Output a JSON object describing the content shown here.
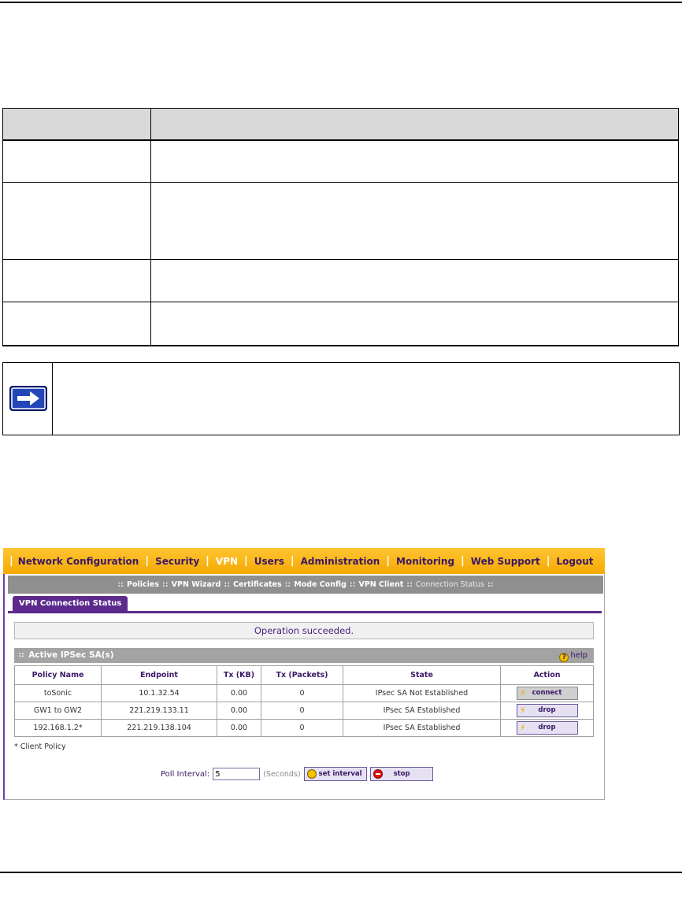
{
  "nav": {
    "items": [
      "Network Configuration",
      "Security",
      "VPN",
      "Users",
      "Administration",
      "Monitoring",
      "Web Support",
      "Logout"
    ],
    "active": "VPN"
  },
  "subnav": {
    "items": [
      "Policies",
      "VPN Wizard",
      "Certificates",
      "Mode Config",
      "VPN Client",
      "Connection Status"
    ],
    "active": "Connection Status",
    "separator": "::"
  },
  "tab": {
    "label": "VPN Connection Status"
  },
  "status": {
    "message": "Operation succeeded."
  },
  "sa_section": {
    "title": "Active IPSec SA(s)",
    "help_label": "help"
  },
  "sa_table": {
    "headers": [
      "Policy Name",
      "Endpoint",
      "Tx (KB)",
      "Tx (Packets)",
      "State",
      "Action"
    ],
    "rows": [
      {
        "policy": "toSonic",
        "endpoint": "10.1.32.54",
        "tx_kb": "0.00",
        "tx_packets": "0",
        "state": "IPsec SA Not Established",
        "action": "connect"
      },
      {
        "policy": "GW1 to GW2",
        "endpoint": "221.219.133.11",
        "tx_kb": "0.00",
        "tx_packets": "0",
        "state": "IPsec SA Established",
        "action": "drop"
      },
      {
        "policy": "192.168.1.2*",
        "endpoint": "221.219.138.104",
        "tx_kb": "0.00",
        "tx_packets": "0",
        "state": "IPsec SA Established",
        "action": "drop"
      }
    ]
  },
  "client_note": "* Client Policy",
  "poll": {
    "label": "Poll Interval:",
    "value": "5",
    "unit": "(Seconds)",
    "set_label": "set interval",
    "stop_label": "stop"
  },
  "colors": {
    "nav_bar": "#f5a800",
    "accent_purple": "#5c2a8c",
    "subnav_grey": "#8f8f8f"
  },
  "icons": {
    "note": "right-arrow-icon",
    "help": "question-icon",
    "connect": "lightning-icon",
    "clock": "clock-icon",
    "stop": "stop-icon"
  }
}
